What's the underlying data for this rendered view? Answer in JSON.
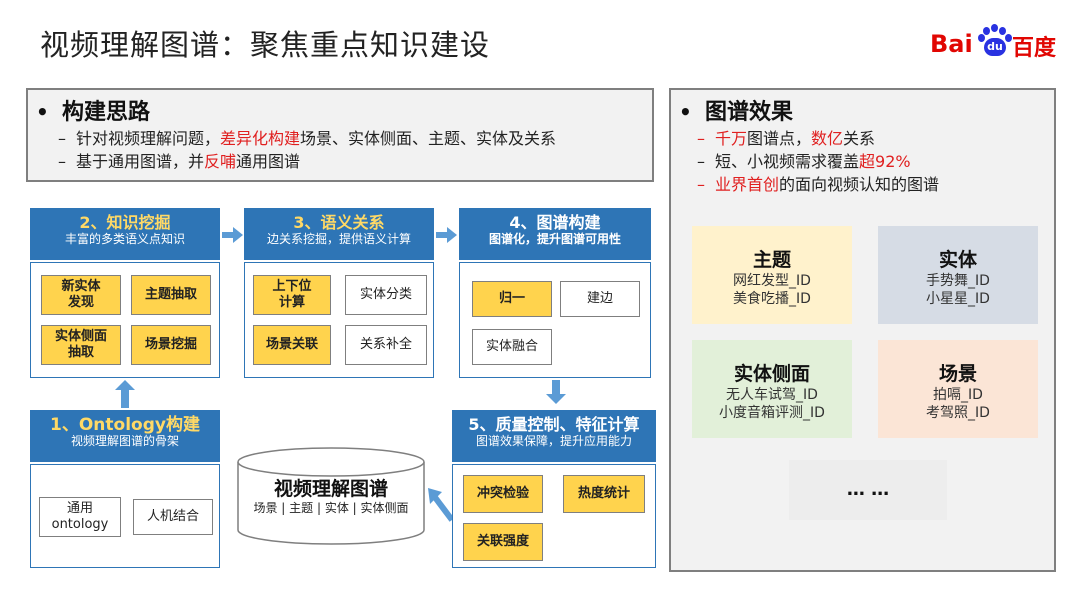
{
  "title": "视频理解图谱：聚焦重点知识建设",
  "logo": {
    "left_text": "Bai",
    "paw_text": "du",
    "right_text": "百度"
  },
  "left_panel": {
    "heading": "构建思路",
    "line1": {
      "a": "针对视频理解问题，",
      "b": "差异化构建",
      "c": "场景、实体侧面、主题、实体及关系"
    },
    "line2": {
      "a": "基于通用图谱，并",
      "b": "反哺",
      "c": "通用图谱"
    }
  },
  "right_panel": {
    "heading": "图谱效果",
    "line1": {
      "a": "千万",
      "b": "图谱点，",
      "c": "数亿",
      "d": "关系"
    },
    "line2": {
      "a": "短、小视频需求覆盖",
      "b": "超92%"
    },
    "line3": {
      "a": "业界首创",
      "b": "的面向视频认知的图谱"
    },
    "tiles": [
      {
        "title": "主题",
        "items": [
          "网红发型_ID",
          "美食吃播_ID"
        ],
        "color": "#fff2cc"
      },
      {
        "title": "实体",
        "items": [
          "手势舞_ID",
          "小星星_ID"
        ],
        "color": "#d6dce5"
      },
      {
        "title": "实体侧面",
        "items": [
          "无人车试驾_ID",
          "小度音箱评测_ID"
        ],
        "color": "#e2f0d9"
      },
      {
        "title": "场景",
        "items": [
          "拍嗝_ID",
          "考驾照_ID"
        ],
        "color": "#fbe5d6"
      }
    ],
    "more": "… …"
  },
  "steps": {
    "s2": {
      "title": "2、知识挖掘",
      "sub": "丰富的多类语义点知识",
      "chips": [
        "新实体\n发现",
        "主题抽取",
        "实体侧面\n抽取",
        "场景挖掘"
      ]
    },
    "s3": {
      "title": "3、语义关系",
      "sub": "边关系挖掘，提供语义计算",
      "chips": [
        "上下位\n计算",
        "实体分类",
        "场景关联",
        "关系补全"
      ]
    },
    "s4": {
      "title": "4、图谱构建",
      "sub": "图谱化，提升图谱可用性",
      "chips": [
        "归一",
        "建边",
        "实体融合"
      ]
    },
    "s1": {
      "title": "1、Ontology构建",
      "sub": "视频理解图谱的骨架",
      "chips": [
        "通用\nontology",
        "人机结合"
      ]
    },
    "s5": {
      "title": "5、质量控制、特征计算",
      "sub": "图谱效果保障，提升应用能力",
      "chips": [
        "冲突检验",
        "热度统计",
        "关联强度"
      ]
    }
  },
  "cylinder": {
    "title": "视频理解图谱",
    "sub": "场景 | 主题 | 实体 | 实体侧面"
  },
  "colors": {
    "header_blue": "#2e75b6",
    "arrow_blue": "#5b9bd5",
    "chip_yellow": "#ffd34d",
    "accent_red": "#e02020"
  }
}
